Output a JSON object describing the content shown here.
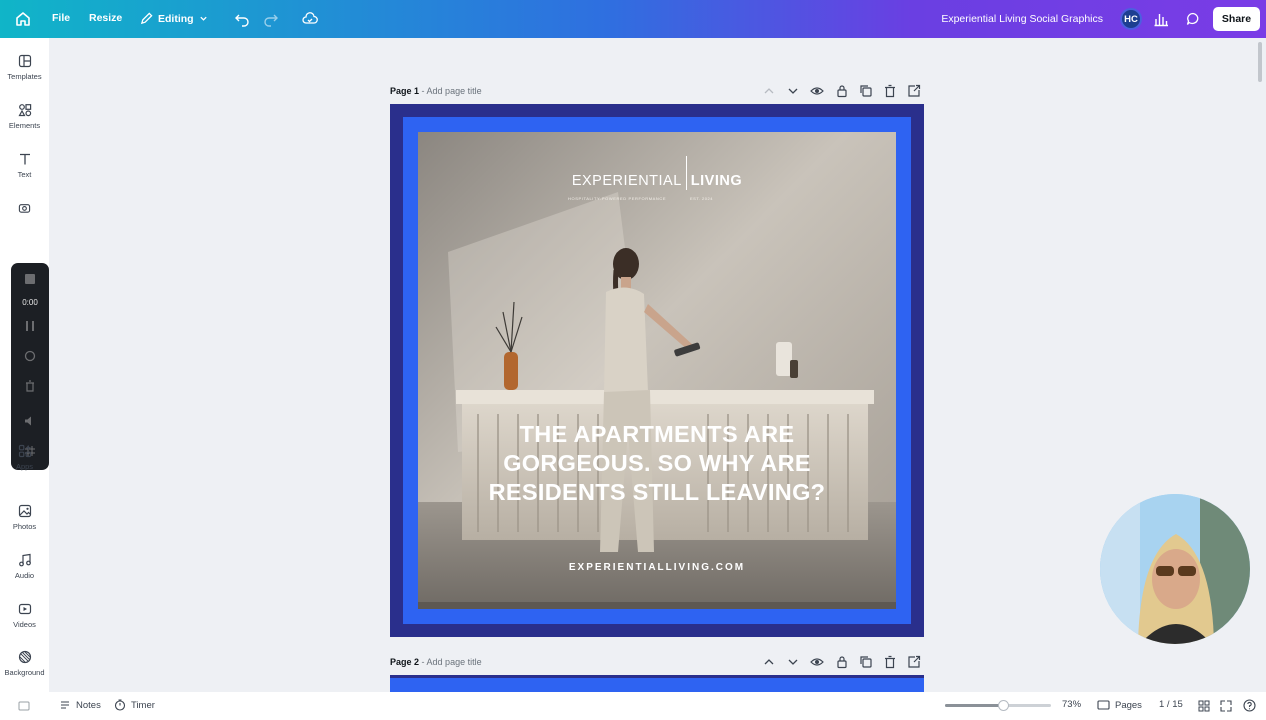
{
  "topbar": {
    "file_label": "File",
    "resize_label": "Resize",
    "editing_label": "Editing",
    "doc_title": "Experiential Living Social Graphics",
    "avatar_initials": "HC",
    "share_label": "Share",
    "gradient_colors": [
      "#10b5c8",
      "#2f6fe0",
      "#7a3ce6"
    ]
  },
  "sidebar": {
    "items": [
      {
        "label": "Templates",
        "icon": "templates-icon"
      },
      {
        "label": "Elements",
        "icon": "elements-icon"
      },
      {
        "label": "Text",
        "icon": "text-icon"
      },
      {
        "label": "Apps",
        "icon": "apps-icon"
      },
      {
        "label": "Photos",
        "icon": "photos-icon"
      },
      {
        "label": "Audio",
        "icon": "audio-icon"
      },
      {
        "label": "Videos",
        "icon": "videos-icon"
      },
      {
        "label": "Background",
        "icon": "background-icon"
      }
    ],
    "recorder_time": "0:00"
  },
  "pages": [
    {
      "label": "Page 1",
      "title_placeholder": "- Add page title"
    },
    {
      "label": "Page 2",
      "title_placeholder": "- Add page title"
    }
  ],
  "design": {
    "logo_word1": "EXPERIENTIAL",
    "logo_word2": "LIVING",
    "logo_tagline": "HOSPITALITY-POWERED PERFORMANCE",
    "logo_est": "EST. 2024",
    "headline_lines": [
      "THE APARTMENTS ARE",
      "GORGEOUS. SO WHY ARE",
      "RESIDENTS STILL LEAVING?"
    ],
    "url": "EXPERIENTIALLIVING.COM",
    "colors": {
      "outer": "#2a2f8c",
      "frame": "#2e63f2"
    }
  },
  "bottombar": {
    "notes_label": "Notes",
    "timer_label": "Timer",
    "zoom_value": "73%",
    "zoom_fraction": 0.55,
    "pages_label": "Pages",
    "page_counter": "1 / 15"
  }
}
